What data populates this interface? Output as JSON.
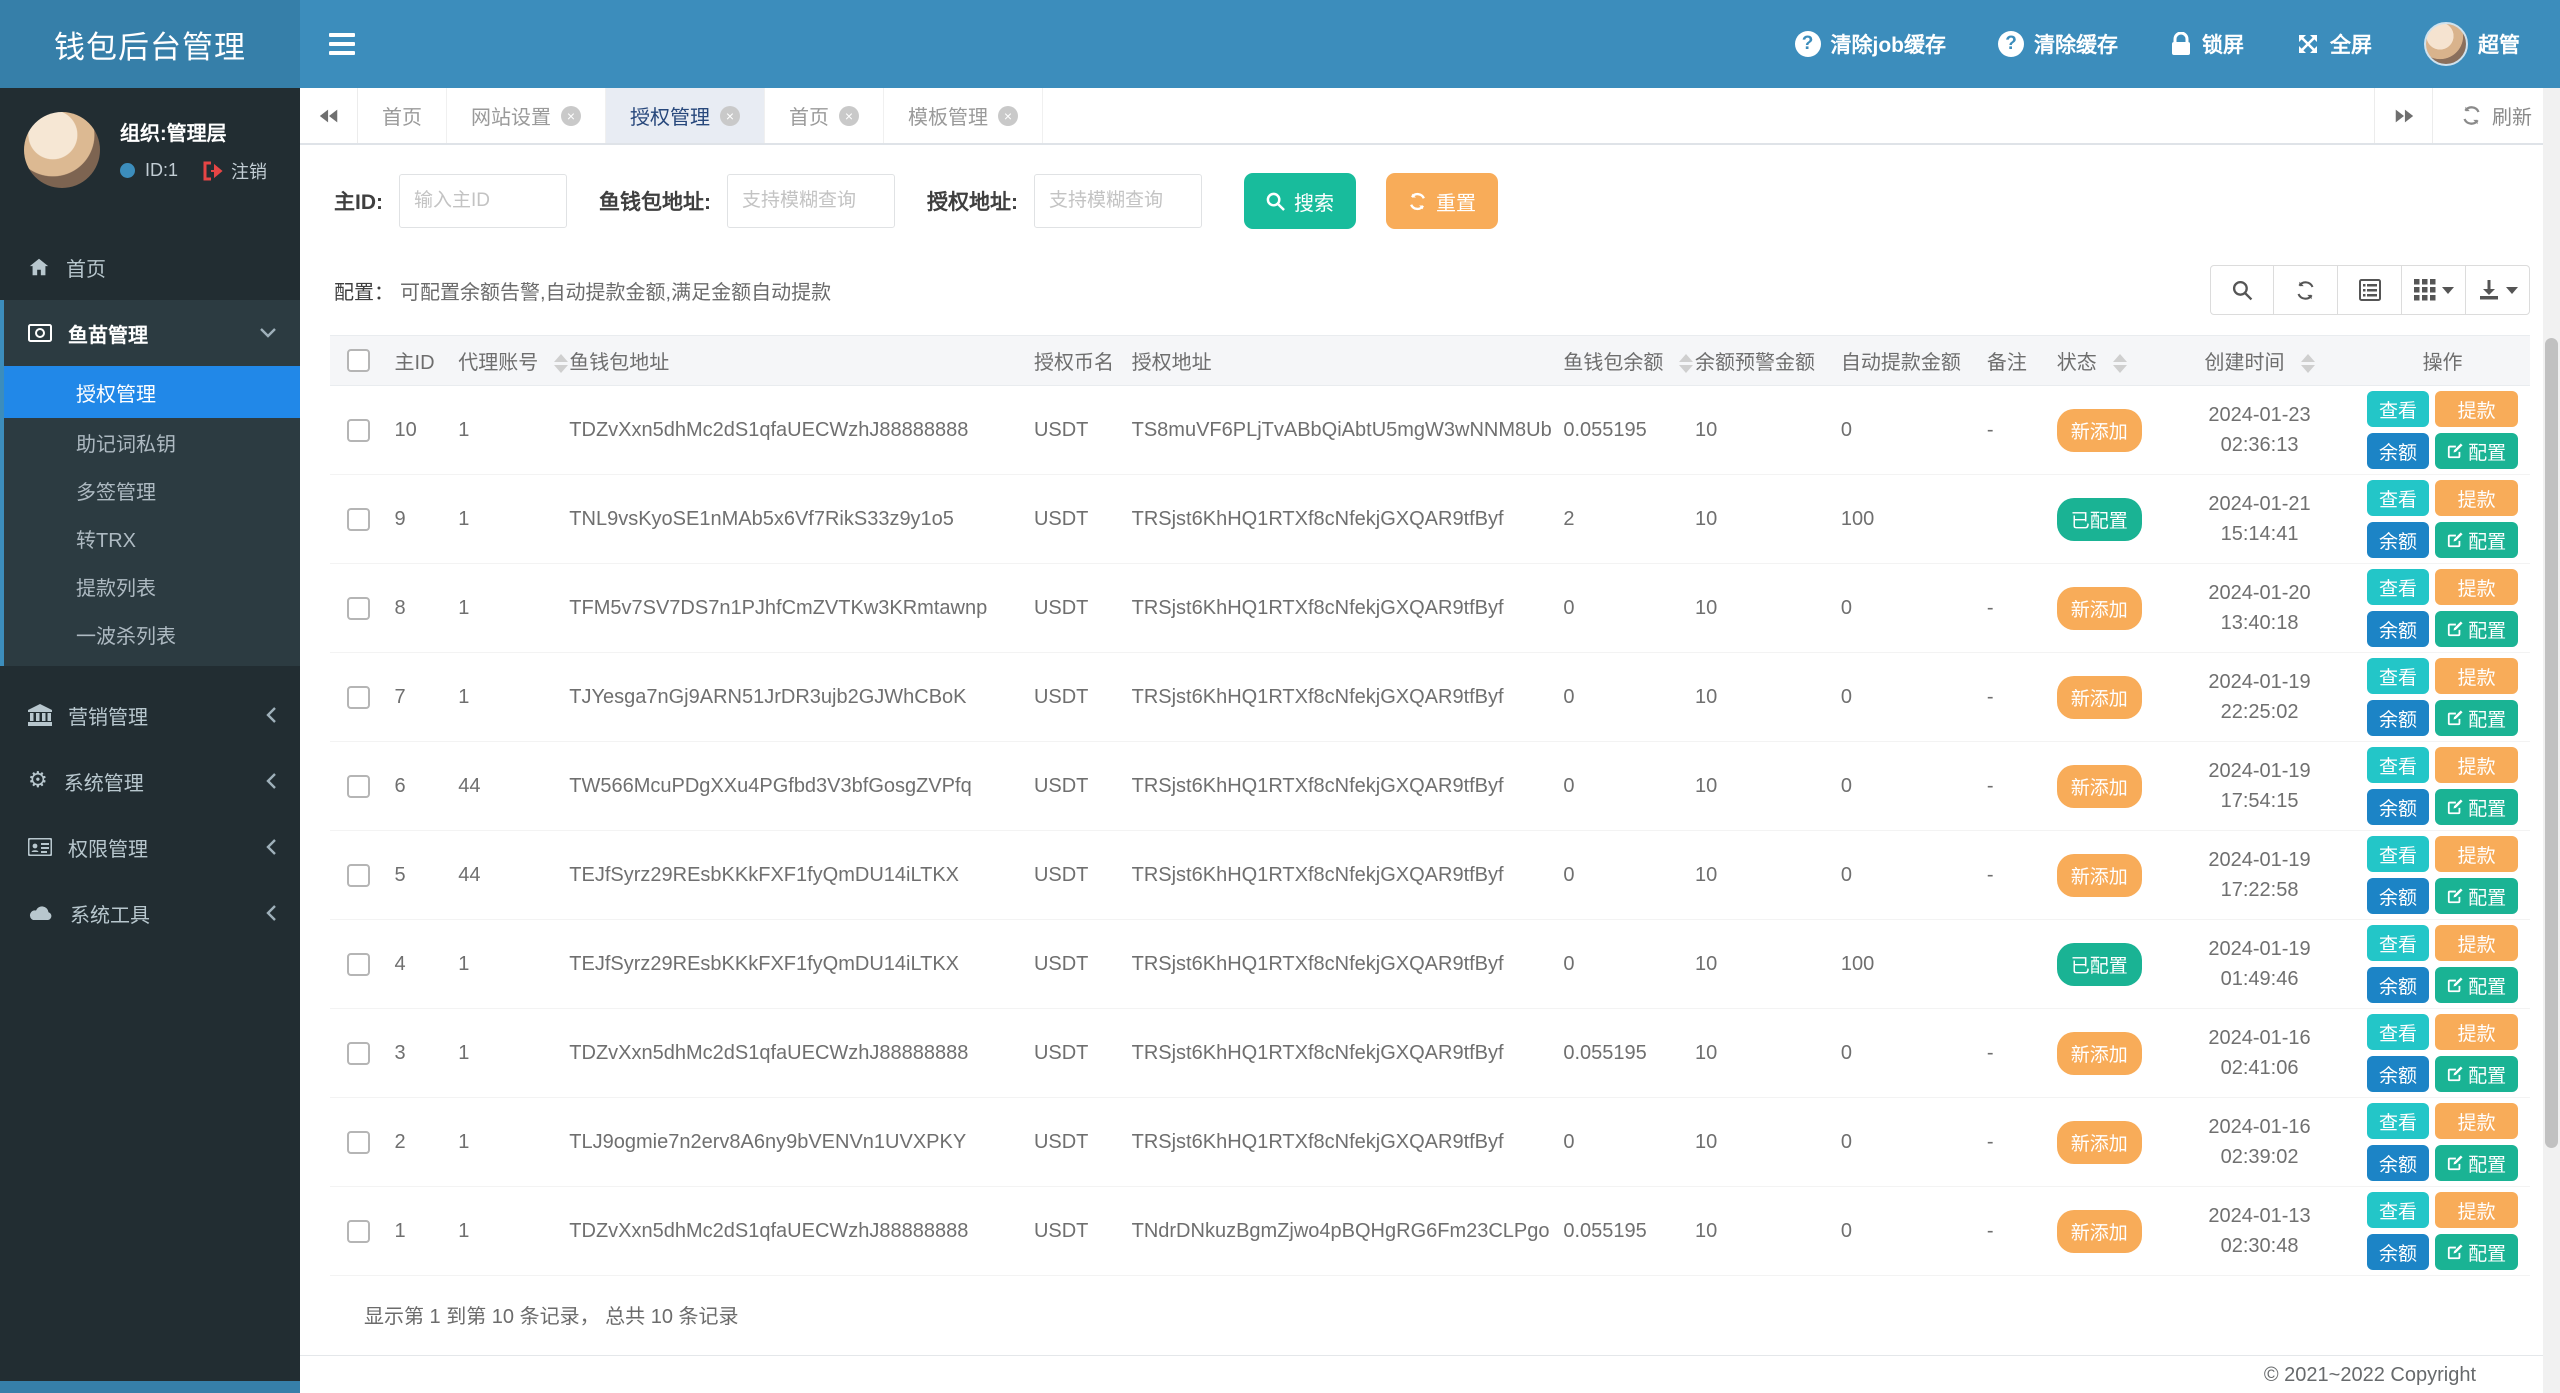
{
  "app": {
    "title": "钱包后台管理",
    "copyright": "© 2021~2022 Copyright"
  },
  "navbar": {
    "items": [
      {
        "label": "清除job缓存",
        "icon": "question-circle"
      },
      {
        "label": "清除缓存",
        "icon": "question-circle"
      },
      {
        "label": "锁屏",
        "icon": "lock"
      },
      {
        "label": "全屏",
        "icon": "fullscreen"
      },
      {
        "label": "超管",
        "icon": "avatar"
      }
    ]
  },
  "sidebar": {
    "profile": {
      "org": "组织:管理层",
      "id": "ID:1",
      "logout": "注销"
    },
    "home": {
      "label": "首页"
    },
    "treeview": {
      "label": "鱼苗管理",
      "children": [
        {
          "label": "授权管理",
          "active": true
        },
        {
          "label": "助记词私钥"
        },
        {
          "label": "多签管理"
        },
        {
          "label": "转TRX"
        },
        {
          "label": "提款列表"
        },
        {
          "label": "一波杀列表"
        }
      ]
    },
    "sections": [
      {
        "label": "营销管理",
        "icon": "bank"
      },
      {
        "label": "系统管理",
        "icon": "gear"
      },
      {
        "label": "权限管理",
        "icon": "id-card"
      },
      {
        "label": "系统工具",
        "icon": "cloud"
      }
    ]
  },
  "tabs": {
    "items": [
      {
        "label": "首页",
        "closable": false
      },
      {
        "label": "网站设置",
        "closable": true
      },
      {
        "label": "授权管理",
        "closable": true,
        "active": true
      },
      {
        "label": "首页",
        "closable": true
      },
      {
        "label": "模板管理",
        "closable": true
      }
    ],
    "refresh_label": "刷新"
  },
  "filters": {
    "fields": [
      {
        "label": "主ID:",
        "placeholder": "输入主ID",
        "value": ""
      },
      {
        "label": "鱼钱包地址:",
        "placeholder": "支持模糊查询",
        "value": ""
      },
      {
        "label": "授权地址:",
        "placeholder": "支持模糊查询",
        "value": ""
      }
    ],
    "search_label": "搜索",
    "reset_label": "重置"
  },
  "config_note": {
    "label": "配置：",
    "text": "可配置余额告警,自动提款金额,满足金额自动提款"
  },
  "table": {
    "columns": [
      {
        "label": "主ID"
      },
      {
        "label": "代理账号",
        "sortable": true
      },
      {
        "label": "鱼钱包地址"
      },
      {
        "label": "授权币名"
      },
      {
        "label": "授权地址"
      },
      {
        "label": "鱼钱包余额",
        "sortable": true
      },
      {
        "label": "余额预警金额"
      },
      {
        "label": "自动提款金额"
      },
      {
        "label": "备注"
      },
      {
        "label": "状态",
        "sortable": true
      },
      {
        "label": "创建时间",
        "sortable": true
      },
      {
        "label": "操作"
      }
    ],
    "actions": [
      "查看",
      "提款",
      "余额",
      "配置"
    ],
    "rows": [
      {
        "id": "10",
        "agent": "1",
        "wallet": "TDZvXxn5dhMc2dS1qfaUECWzhJ88888888",
        "coin": "USDT",
        "auth_addr": "TS8muVF6PLjTvABbQiAbtU5mgW3wNNM8Ub",
        "balance": "0.055195",
        "warn": "10",
        "auto": "0",
        "remark": "-",
        "status": "新添加",
        "status_type": "orange",
        "date": "2024-01-23",
        "time": "02:36:13"
      },
      {
        "id": "9",
        "agent": "1",
        "wallet": "TNL9vsKyoSE1nMAb5x6Vf7RikS33z9y1o5",
        "coin": "USDT",
        "auth_addr": "TRSjst6KhHQ1RTXf8cNfekjGXQAR9tfByf",
        "balance": "2",
        "warn": "10",
        "auto": "100",
        "remark": "",
        "status": "已配置",
        "status_type": "green",
        "date": "2024-01-21",
        "time": "15:14:41"
      },
      {
        "id": "8",
        "agent": "1",
        "wallet": "TFM5v7SV7DS7n1PJhfCmZVTKw3KRmtawnp",
        "coin": "USDT",
        "auth_addr": "TRSjst6KhHQ1RTXf8cNfekjGXQAR9tfByf",
        "balance": "0",
        "warn": "10",
        "auto": "0",
        "remark": "-",
        "status": "新添加",
        "status_type": "orange",
        "date": "2024-01-20",
        "time": "13:40:18"
      },
      {
        "id": "7",
        "agent": "1",
        "wallet": "TJYesga7nGj9ARN51JrDR3ujb2GJWhCBoK",
        "coin": "USDT",
        "auth_addr": "TRSjst6KhHQ1RTXf8cNfekjGXQAR9tfByf",
        "balance": "0",
        "warn": "10",
        "auto": "0",
        "remark": "-",
        "status": "新添加",
        "status_type": "orange",
        "date": "2024-01-19",
        "time": "22:25:02"
      },
      {
        "id": "6",
        "agent": "44",
        "wallet": "TW566McuPDgXXu4PGfbd3V3bfGosgZVPfq",
        "coin": "USDT",
        "auth_addr": "TRSjst6KhHQ1RTXf8cNfekjGXQAR9tfByf",
        "balance": "0",
        "warn": "10",
        "auto": "0",
        "remark": "-",
        "status": "新添加",
        "status_type": "orange",
        "date": "2024-01-19",
        "time": "17:54:15"
      },
      {
        "id": "5",
        "agent": "44",
        "wallet": "TEJfSyrz29REsbKKkFXF1fyQmDU14iLTKX",
        "coin": "USDT",
        "auth_addr": "TRSjst6KhHQ1RTXf8cNfekjGXQAR9tfByf",
        "balance": "0",
        "warn": "10",
        "auto": "0",
        "remark": "-",
        "status": "新添加",
        "status_type": "orange",
        "date": "2024-01-19",
        "time": "17:22:58"
      },
      {
        "id": "4",
        "agent": "1",
        "wallet": "TEJfSyrz29REsbKKkFXF1fyQmDU14iLTKX",
        "coin": "USDT",
        "auth_addr": "TRSjst6KhHQ1RTXf8cNfekjGXQAR9tfByf",
        "balance": "0",
        "warn": "10",
        "auto": "100",
        "remark": "",
        "status": "已配置",
        "status_type": "green",
        "date": "2024-01-19",
        "time": "01:49:46"
      },
      {
        "id": "3",
        "agent": "1",
        "wallet": "TDZvXxn5dhMc2dS1qfaUECWzhJ88888888",
        "coin": "USDT",
        "auth_addr": "TRSjst6KhHQ1RTXf8cNfekjGXQAR9tfByf",
        "balance": "0.055195",
        "warn": "10",
        "auto": "0",
        "remark": "-",
        "status": "新添加",
        "status_type": "orange",
        "date": "2024-01-16",
        "time": "02:41:06"
      },
      {
        "id": "2",
        "agent": "1",
        "wallet": "TLJ9ogmie7n2erv8A6ny9bVENVn1UVXPKY",
        "coin": "USDT",
        "auth_addr": "TRSjst6KhHQ1RTXf8cNfekjGXQAR9tfByf",
        "balance": "0",
        "warn": "10",
        "auto": "0",
        "remark": "-",
        "status": "新添加",
        "status_type": "orange",
        "date": "2024-01-16",
        "time": "02:39:02"
      },
      {
        "id": "1",
        "agent": "1",
        "wallet": "TDZvXxn5dhMc2dS1qfaUECWzhJ88888888",
        "coin": "USDT",
        "auth_addr": "TNdrDNkuzBgmZjwo4pBQHgRG6Fm23CLPgo",
        "balance": "0.055195",
        "warn": "10",
        "auto": "0",
        "remark": "-",
        "status": "新添加",
        "status_type": "orange",
        "date": "2024-01-13",
        "time": "02:30:48"
      }
    ],
    "summary": "显示第 1 到第 10 条记录， 总共 10 条记录"
  },
  "colors": {
    "navbar": "#3c8dbc",
    "logo": "#367fa9",
    "sidebar": "#222d32",
    "active_menu": "#2188e8",
    "green": "#18bc9c",
    "orange": "#f8ac59",
    "cyan": "#23c6c8",
    "blue": "#1c84c6",
    "teal": "#1ab394"
  }
}
